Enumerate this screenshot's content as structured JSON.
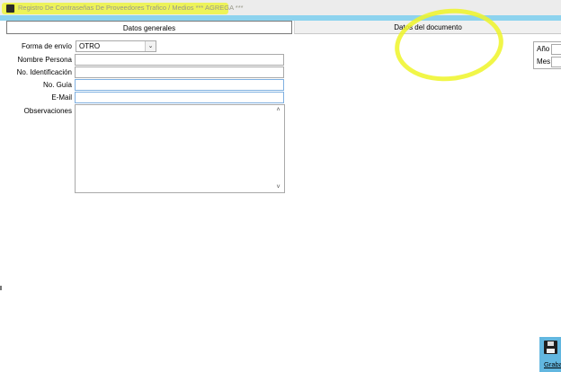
{
  "window": {
    "title": "Registro De Contraseñas De Proveedores Trafico / Medios  *** AGREGA ***",
    "highlight_color": "#eef528"
  },
  "tabs": [
    {
      "label": "Datos generales",
      "active": true
    },
    {
      "label": "Datos del documento",
      "active": false
    }
  ],
  "form": {
    "forma_envio": {
      "label": "Forma de envío",
      "value": "OTRO"
    },
    "nombre_persona": {
      "label": "Nombre Persona",
      "value": ""
    },
    "no_identificacion": {
      "label": "No. Identificación",
      "value": ""
    },
    "no_guia": {
      "label": "No. Guía",
      "value": ""
    },
    "email": {
      "label": "E-Mail",
      "value": ""
    },
    "observaciones": {
      "label": "Observaciones",
      "value": ""
    }
  },
  "right_panel": {
    "anio_label": "Año",
    "mes_label": "Mes"
  },
  "toolbar": {
    "save_label": "Graba",
    "save_icon": "floppy-disk-icon"
  },
  "colors": {
    "accent_bar": "#8dd3ee",
    "save_button": "#62b7e0"
  }
}
